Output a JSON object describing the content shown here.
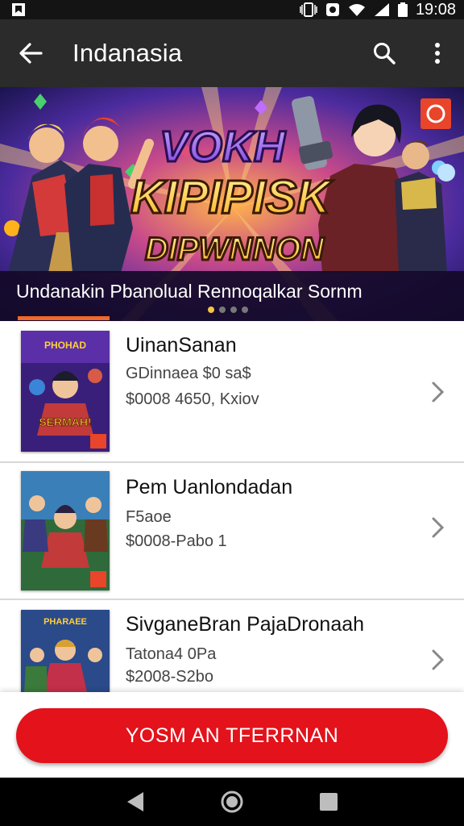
{
  "status_bar": {
    "time": "19:08"
  },
  "app_bar": {
    "title": "Indanasia"
  },
  "banner": {
    "headline": [
      "VOKH",
      "KIPIPISK",
      "DIPWNNON"
    ],
    "corner_badge": "ʘ",
    "caption": "Undanakin Pbanolual Rennoqalkar Sornm",
    "dots_total": 4,
    "dots_active": 0
  },
  "items": [
    {
      "name": "UinanSanan",
      "line1": "GDinnaea $0 sa$",
      "line2": "$0008 4650, Kxiov",
      "thumb_title": "SERMAH!"
    },
    {
      "name": "Pem Uanlondadan",
      "line1": "F5aoe",
      "line2": "$0008-Pabo 1",
      "thumb_title": ""
    },
    {
      "name": "SivganeBran PajaDronaah",
      "line1": "Tatona4 0Pa",
      "line2": "$2008-S2bo",
      "thumb_title": ""
    }
  ],
  "cta": {
    "label": "YOSM AN TFERRNAN"
  },
  "colors": {
    "accent": "#e3121b",
    "appbar": "#2b2b2b",
    "tab_indicator": "#f0682a"
  }
}
